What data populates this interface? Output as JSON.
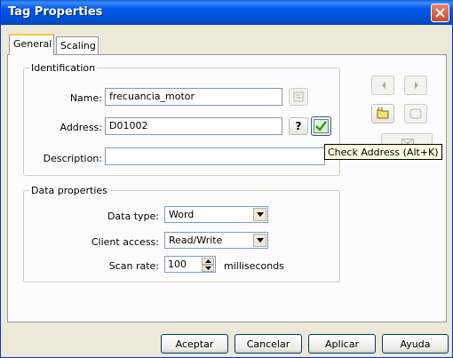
{
  "window": {
    "title": "Tag Properties"
  },
  "tabs": [
    {
      "label": "General",
      "active": true
    },
    {
      "label": "Scaling",
      "active": false
    }
  ],
  "identification": {
    "legend": "Identification",
    "name_label": "Name:",
    "name_value": "frecuancia_motor",
    "address_label": "Address:",
    "address_value": "D01002",
    "help_label": "?",
    "description_label": "Description:",
    "description_value": ""
  },
  "data_properties": {
    "legend": "Data properties",
    "data_type_label": "Data type:",
    "data_type_value": "Word",
    "client_access_label": "Client access:",
    "client_access_value": "Read/Write",
    "scan_rate_label": "Scan rate:",
    "scan_rate_value": "100",
    "scan_rate_unit": "milliseconds"
  },
  "tooltip": {
    "text": "Check Address (Alt+K)"
  },
  "buttons": {
    "accept": "Aceptar",
    "cancel": "Cancelar",
    "apply": "Aplicar",
    "help": "Ayuda"
  },
  "icons": [
    "close-icon",
    "browse-icon",
    "check-icon",
    "previous-icon",
    "next-icon",
    "new-tag-icon",
    "duplicate-icon",
    "delete-icon",
    "dropdown-arrow-icon",
    "spin-up-icon",
    "spin-down-icon"
  ],
  "colors": {
    "title_bar": "#0058ee",
    "dialog_bg": "#ece9d8",
    "panel_bg": "#fcfcfe",
    "tooltip_bg": "#ffffe1",
    "check_green": "#2c9a2c"
  }
}
